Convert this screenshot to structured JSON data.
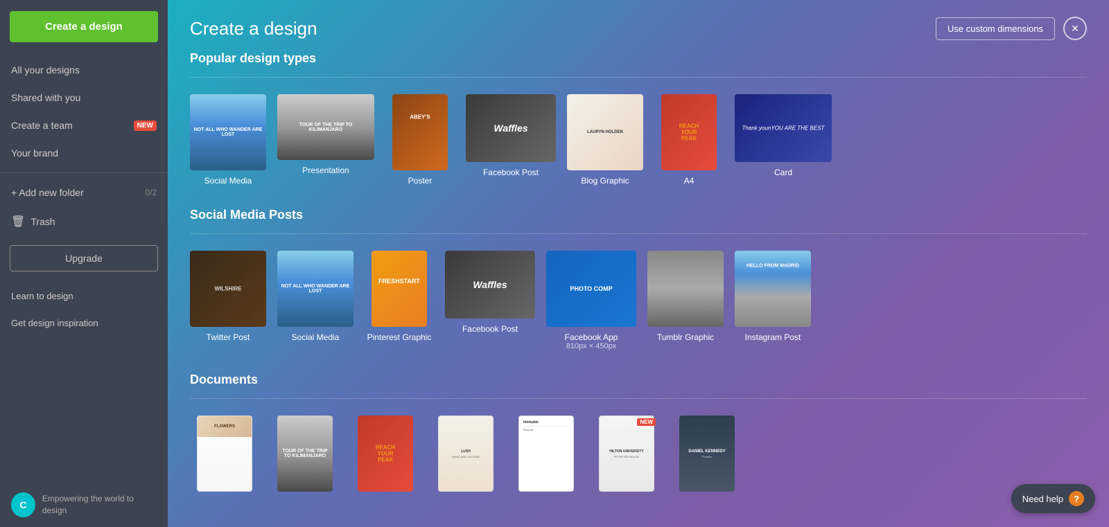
{
  "sidebar": {
    "create_button_label": "Create a design",
    "nav_items": [
      {
        "id": "all-designs",
        "label": "All your designs",
        "icon": ""
      },
      {
        "id": "shared",
        "label": "Shared with you",
        "icon": ""
      },
      {
        "id": "create-team",
        "label": "Create a team",
        "icon": "",
        "badge": "NEW"
      },
      {
        "id": "your-brand",
        "label": "Your brand",
        "icon": ""
      },
      {
        "id": "add-folder",
        "label": "+ Add new folder",
        "icon": "",
        "count": "0/2"
      },
      {
        "id": "trash",
        "label": "Trash",
        "icon": "🗑"
      }
    ],
    "upgrade_label": "Upgrade",
    "bottom_nav": [
      {
        "id": "learn",
        "label": "Learn to design"
      },
      {
        "id": "inspiration",
        "label": "Get design inspiration"
      }
    ],
    "footer_logo": "C",
    "footer_text": "Empowering the world to design"
  },
  "main": {
    "title": "Create a design",
    "custom_dimensions_label": "Use custom dimensions",
    "close_label": "×",
    "sections": [
      {
        "id": "popular",
        "title": "Popular design types",
        "items": [
          {
            "id": "social-media",
            "label": "Social Media",
            "sublabel": ""
          },
          {
            "id": "presentation",
            "label": "Presentation",
            "sublabel": ""
          },
          {
            "id": "poster",
            "label": "Poster",
            "sublabel": ""
          },
          {
            "id": "facebook-post",
            "label": "Facebook Post",
            "sublabel": ""
          },
          {
            "id": "blog-graphic",
            "label": "Blog Graphic",
            "sublabel": ""
          },
          {
            "id": "a4",
            "label": "A4",
            "sublabel": ""
          },
          {
            "id": "card",
            "label": "Card",
            "sublabel": ""
          }
        ]
      },
      {
        "id": "social-media-posts",
        "title": "Social Media Posts",
        "items": [
          {
            "id": "twitter-post",
            "label": "Twitter Post",
            "sublabel": ""
          },
          {
            "id": "social-media",
            "label": "Social Media",
            "sublabel": ""
          },
          {
            "id": "pinterest-graphic",
            "label": "Pinterest Graphic",
            "sublabel": ""
          },
          {
            "id": "facebook-post2",
            "label": "Facebook Post",
            "sublabel": ""
          },
          {
            "id": "facebook-app",
            "label": "Facebook App",
            "sublabel": "810px × 450px"
          },
          {
            "id": "tumblr-graphic",
            "label": "Tumblr Graphic",
            "sublabel": ""
          },
          {
            "id": "instagram-post",
            "label": "Instagram Post",
            "sublabel": ""
          }
        ]
      },
      {
        "id": "documents",
        "title": "Documents",
        "items": [
          {
            "id": "doc1",
            "label": "",
            "sublabel": ""
          },
          {
            "id": "doc2",
            "label": "",
            "sublabel": ""
          },
          {
            "id": "doc3",
            "label": "",
            "sublabel": ""
          },
          {
            "id": "doc4",
            "label": "",
            "sublabel": ""
          },
          {
            "id": "doc5",
            "label": "",
            "sublabel": ""
          },
          {
            "id": "doc6",
            "label": "",
            "sublabel": "NEW"
          },
          {
            "id": "doc7",
            "label": "",
            "sublabel": ""
          }
        ]
      }
    ]
  },
  "help": {
    "label": "Need help",
    "icon": "?"
  }
}
